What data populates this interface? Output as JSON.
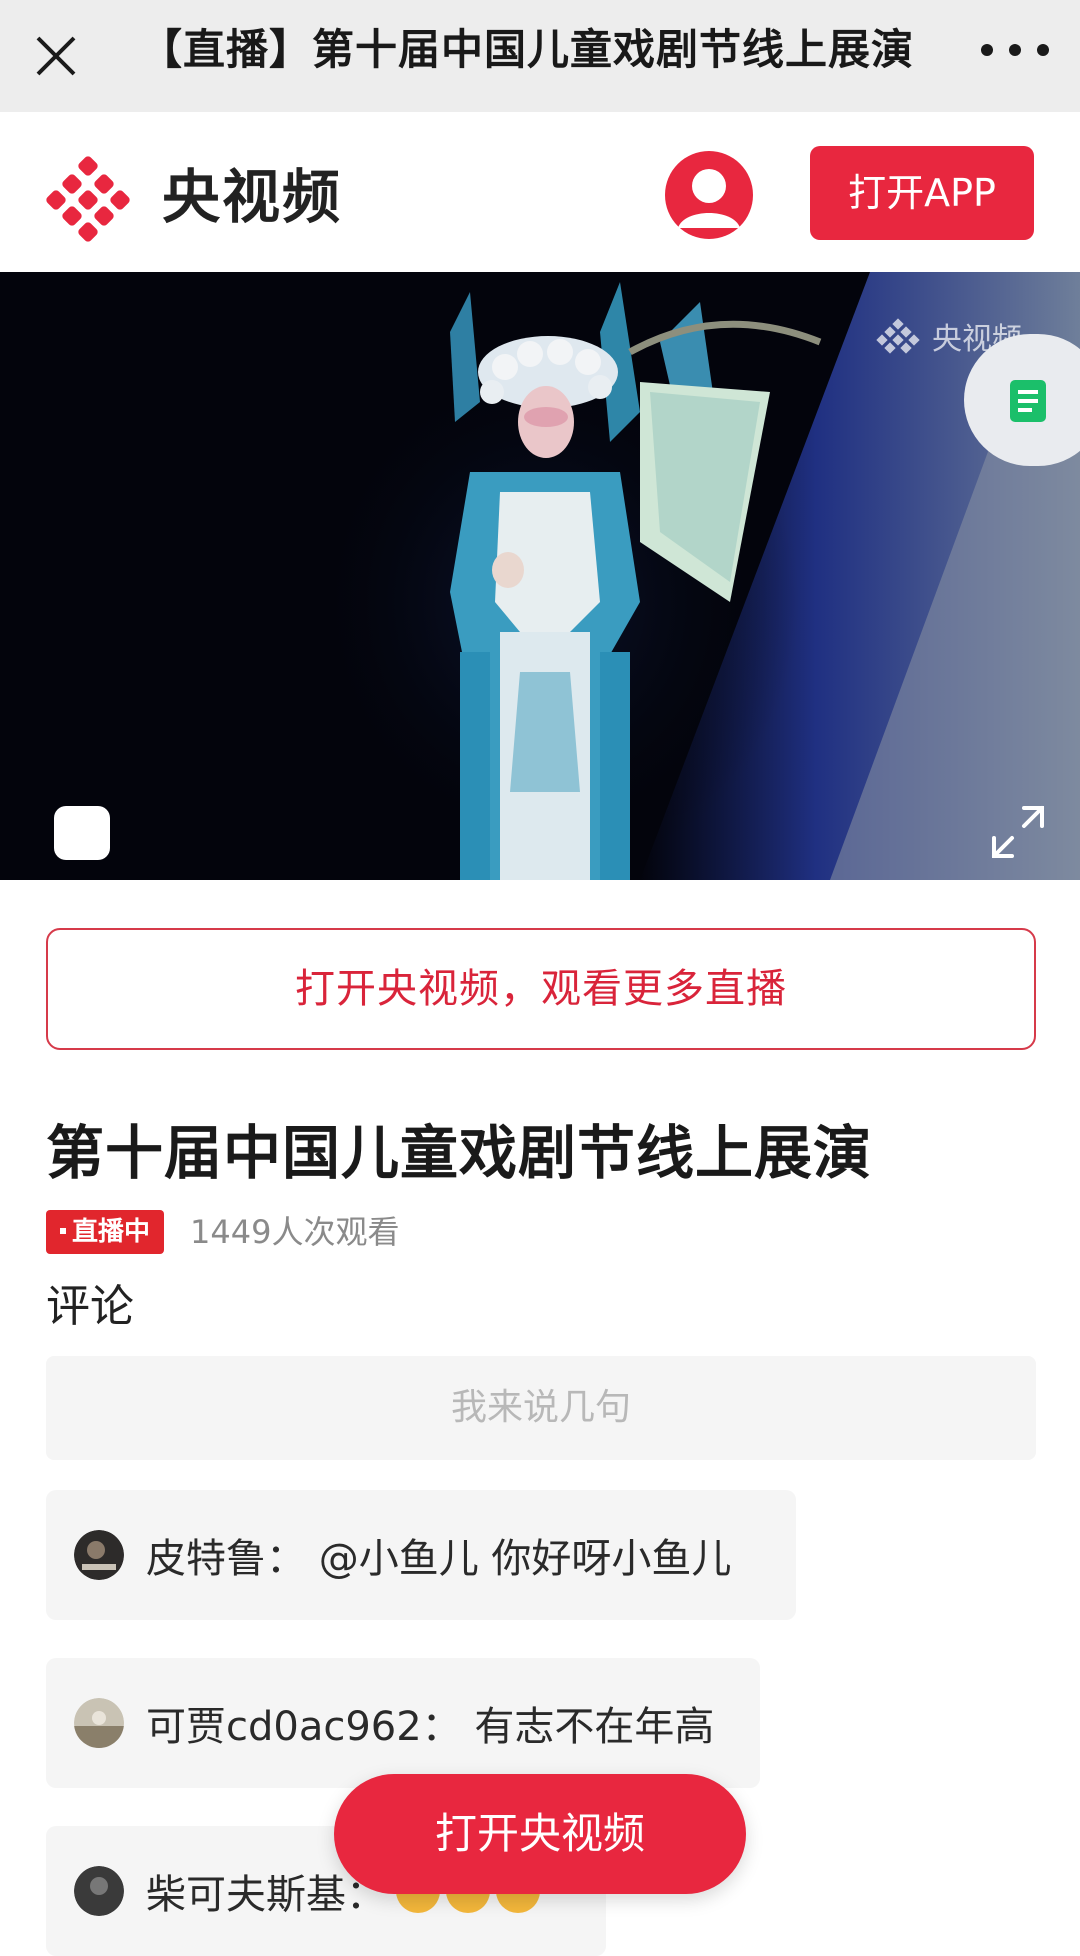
{
  "topbar": {
    "title": "【直播】第十届中国儿童戏剧节线上展演"
  },
  "brand": {
    "name": "央视频",
    "open_app_label": "打开APP"
  },
  "video": {
    "watermark": "央视频"
  },
  "open_more_label": "打开央视频，观看更多直播",
  "program": {
    "title": "第十届中国儿童戏剧节线上展演",
    "live_badge": "直播中",
    "views": "1449人次观看"
  },
  "comments_section": {
    "label": "评论",
    "input_placeholder": "我来说几句",
    "items": [
      {
        "text": "皮特鲁：  @小鱼儿 你好呀小鱼儿"
      },
      {
        "text": "可贾cd0ac962：  有志不在年高"
      },
      {
        "text": "柴可夫斯基："
      }
    ]
  },
  "float_button_label": "打开央视频",
  "colors": {
    "accent": "#e8273f",
    "live": "#e1262d"
  }
}
